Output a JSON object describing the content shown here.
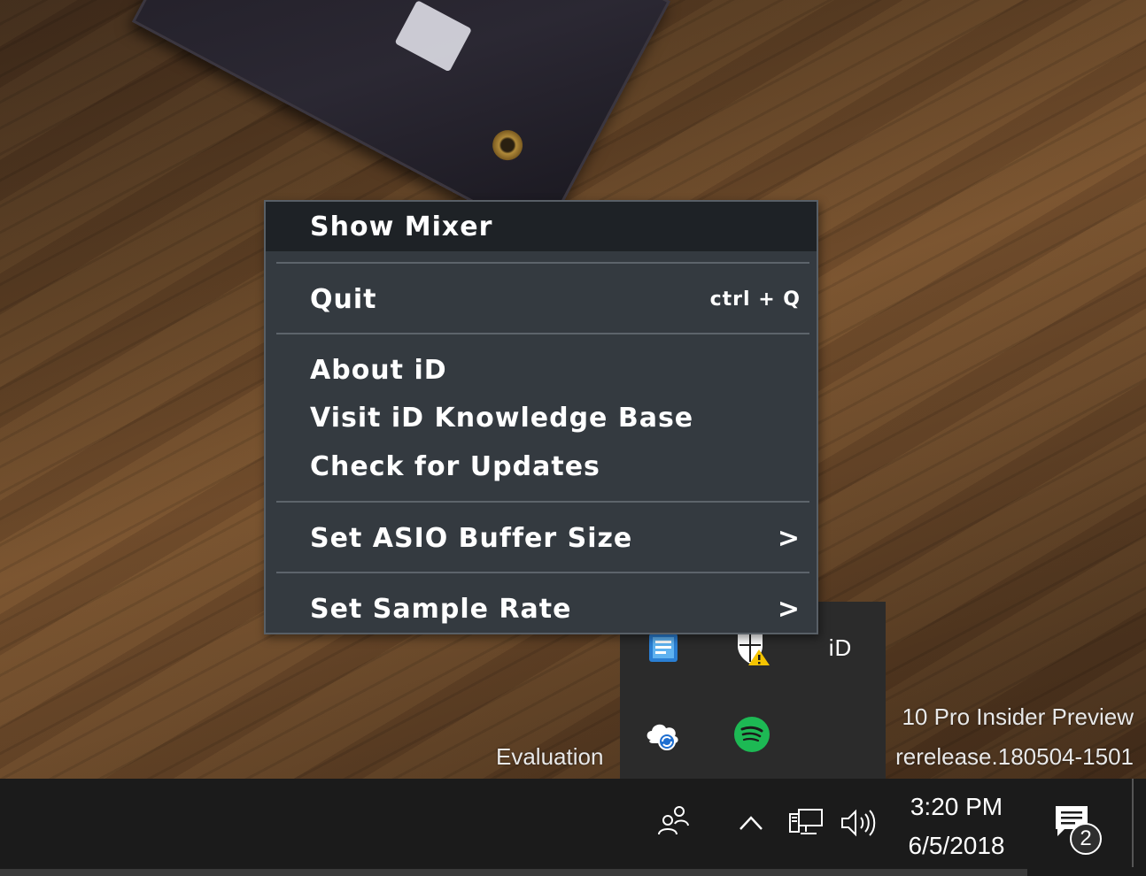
{
  "context_menu": {
    "items": [
      {
        "label": "Show Mixer",
        "highlighted": true
      },
      {
        "label": "Quit",
        "shortcut": "ctrl + Q"
      },
      {
        "label": "About iD"
      },
      {
        "label": "Visit iD Knowledge Base"
      },
      {
        "label": "Check for Updates"
      },
      {
        "label": "Set ASIO Buffer Size",
        "has_submenu": true,
        "submenu_glyph": ">"
      },
      {
        "label": "Set Sample Rate",
        "has_submenu": true,
        "submenu_glyph": ">"
      }
    ]
  },
  "tray_overflow": {
    "icons": [
      "intel-graphics-icon",
      "windows-defender-warning-icon",
      "id-audio-icon",
      "onedrive-sync-icon",
      "spotify-icon"
    ],
    "id_label": "iD"
  },
  "desktop": {
    "watermark_line1": "10 Pro Insider Preview",
    "watermark_line2": "rerelease.180504-1501",
    "watermark_eval": "Evaluation"
  },
  "taskbar": {
    "time": "3:20 PM",
    "date": "6/5/2018",
    "notification_count": "2",
    "icons": [
      "people-icon",
      "show-hidden-icons-chevron",
      "network-icon",
      "volume-icon",
      "action-center-icon"
    ]
  },
  "colors": {
    "menu_bg": "#343a40",
    "menu_highlight": "#1e2226",
    "taskbar_bg": "#1b1b1b",
    "spotify_green": "#1db954"
  }
}
